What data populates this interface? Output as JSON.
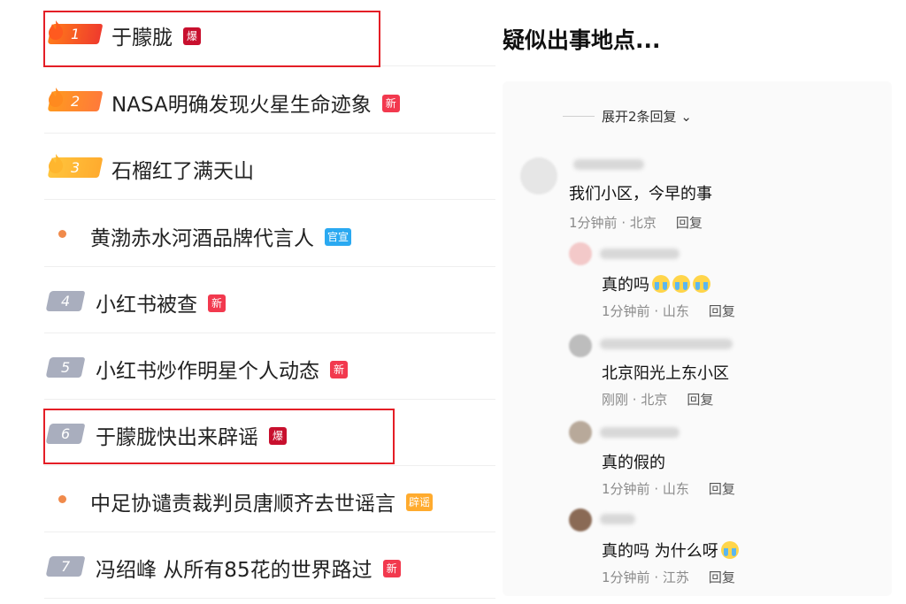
{
  "hot_search": {
    "items": [
      {
        "rank": "1",
        "title": "于朦胧",
        "badge": "爆",
        "badge_type": "bao",
        "rank_style": "hot1"
      },
      {
        "rank": "2",
        "title": "NASA明确发现火星生命迹象",
        "badge": "新",
        "badge_type": "xin",
        "rank_style": "hot2"
      },
      {
        "rank": "3",
        "title": "石榴红了满天山",
        "badge": "",
        "badge_type": "",
        "rank_style": "hot3"
      },
      {
        "rank": "",
        "title": "黄渤赤水河酒品牌代言人",
        "badge": "官宣",
        "badge_type": "guan",
        "rank_style": "dot"
      },
      {
        "rank": "4",
        "title": "小红书被查",
        "badge": "新",
        "badge_type": "xin",
        "rank_style": "grey"
      },
      {
        "rank": "5",
        "title": "小红书炒作明星个人动态",
        "badge": "新",
        "badge_type": "xin",
        "rank_style": "grey"
      },
      {
        "rank": "6",
        "title": "于朦胧快出来辟谣",
        "badge": "爆",
        "badge_type": "bao",
        "rank_style": "grey"
      },
      {
        "rank": "",
        "title": "中足协谴责裁判员唐顺齐去世谣言",
        "badge": "辟谣",
        "badge_type": "piyao",
        "rank_style": "dot"
      },
      {
        "rank": "7",
        "title": "冯绍峰 从所有85花的世界路过",
        "badge": "新",
        "badge_type": "xin",
        "rank_style": "grey"
      }
    ],
    "highlight_color": "#e41e26"
  },
  "comments": {
    "caption": "疑似出事地点...",
    "expand_label": "展开2条回复",
    "expand_icon": "chevron-down-icon",
    "reply_label": "回复",
    "items": [
      {
        "text": "我们小区，今早的事",
        "time": "1分钟前",
        "location": "北京",
        "emoji_count": 0
      },
      {
        "text": "真的吗",
        "time": "1分钟前",
        "location": "山东",
        "emoji_count": 3
      },
      {
        "text": "北京阳光上东小区",
        "time": "刚刚",
        "location": "北京",
        "emoji_count": 0
      },
      {
        "text": "真的假的",
        "time": "1分钟前",
        "location": "山东",
        "emoji_count": 0
      },
      {
        "text": "真的吗 为什么呀",
        "time": "1分钟前",
        "location": "江苏",
        "emoji_count": 1
      }
    ]
  }
}
